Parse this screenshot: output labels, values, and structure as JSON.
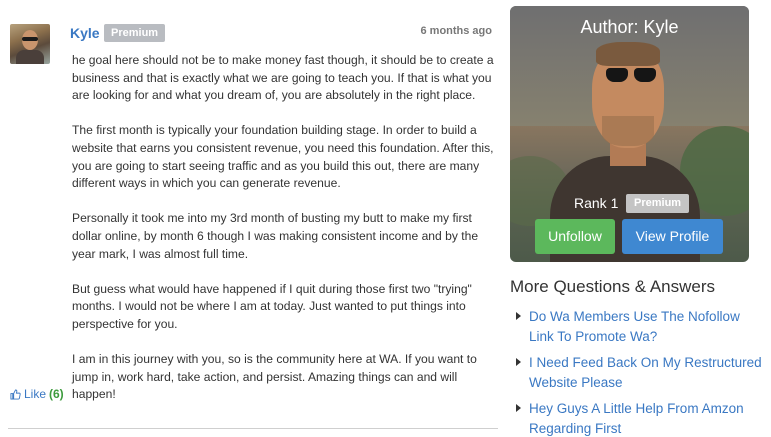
{
  "post": {
    "username": "Kyle",
    "badge": "Premium",
    "timestamp": "6 months ago",
    "paragraphs": [
      "he goal here should not be to make money fast though, it should be to create a business and that is exactly what we are going to teach you. If that is what you are looking for and what you dream of, you are absolutely in the right place.",
      "The first month is typically your foundation building stage. In order to build a website that earns you consistent revenue, you need this foundation. After this, you are going to start seeing traffic and as you build this out, there are many different ways in which you can generate revenue.",
      "Personally it took me into my 3rd month of busting my butt to make my first dollar online, by month 6 though I was making consistent income and by the year mark, I was almost full time.",
      "But guess what would have happened if I quit during those first two \"trying\" months. I would not be where I am at today. Just wanted to put things into perspective for you.",
      "I am in this journey with you, so is the community here at WA. If you want to jump in, work hard, take action, and persist. Amazing things can and will happen!"
    ],
    "like_label": "Like",
    "like_count": "(6)",
    "icons": {
      "like": "thumbs-up-icon",
      "avatar": "avatar"
    }
  },
  "author": {
    "title": "Author: Kyle",
    "rank_label": "Rank 1",
    "badge": "Premium",
    "unfollow_label": "Unfollow",
    "view_profile_label": "View Profile"
  },
  "more_questions": {
    "heading": "More Questions & Answers",
    "items": [
      "Do Wa Members Use The Nofollow Link To Promote Wa?",
      "I Need Feed Back On My Restructured Website Please",
      "Hey Guys A Little Help From Amzon Regarding First"
    ]
  },
  "colors": {
    "link": "#3a78c3",
    "unfollow": "#5cb85c",
    "view_profile": "#3f88d1",
    "badge": "#b9bcc1",
    "like_count": "#3d9b3d"
  }
}
